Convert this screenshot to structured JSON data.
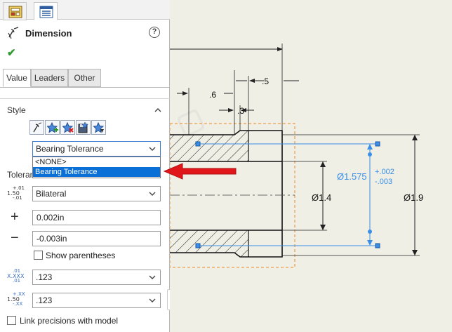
{
  "top_tabs": [
    {
      "icon": "dimxpert-icon",
      "active": false
    },
    {
      "icon": "property-manager-icon",
      "active": true
    }
  ],
  "header": {
    "title": "Dimension",
    "help_glyph": "?"
  },
  "sub_tabs": [
    "Value",
    "Leaders",
    "Other"
  ],
  "style": {
    "label": "Style",
    "buttons": [
      "apply-style-icon",
      "add-style-icon",
      "delete-style-icon",
      "save-style-icon",
      "load-style-icon"
    ],
    "selected": "Bearing Tolerance",
    "options": [
      "<NONE>",
      "Bearing Tolerance"
    ]
  },
  "tolerance": {
    "label": "Tolerance/Precision",
    "type_value": "Bilateral",
    "type_icon": {
      "top": "+.01",
      "mid": "1.50",
      "bot": "-.01"
    },
    "plus_value": "0.002in",
    "minus_value": "-0.003in",
    "show_parentheses_label": "Show parentheses",
    "show_parentheses": false,
    "primary_precision": ".123",
    "primary_icon": {
      "top": ".01",
      "mid": "X.XXX",
      "bot": ".01"
    },
    "tol_precision": ".123",
    "tol_icon": {
      "top": "+.XX",
      "mid": "1.50",
      "bot": "-.XX"
    },
    "link_label": "Link precisions with model"
  },
  "drawing": {
    "dims": [
      ".5",
      ".6",
      ".3",
      "Ø1.4",
      "Ø1.9"
    ],
    "bearing_dim": {
      "base": "Ø1.575",
      "upper": "+.002",
      "lower": "-.003"
    }
  },
  "colors": {
    "accent": "#0a6fd6",
    "arrow": "#e0161a",
    "selection": "#3a8ee6",
    "frame": "#f08a24"
  }
}
